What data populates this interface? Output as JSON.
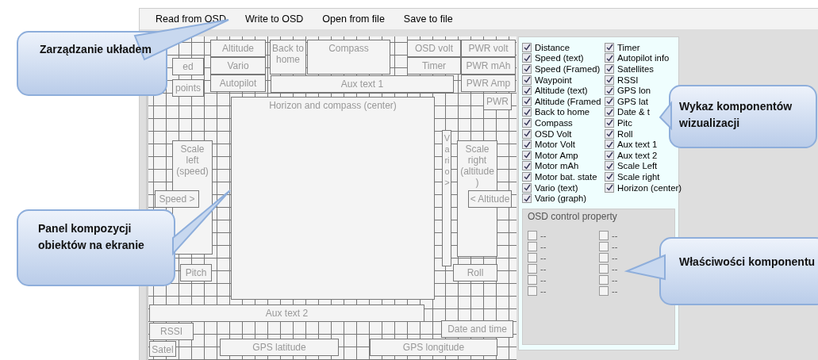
{
  "menu": [
    {
      "label": "Read from OSD"
    },
    {
      "label": "Write to OSD"
    },
    {
      "label": "Open from file"
    },
    {
      "label": "Save to file"
    }
  ],
  "canvas_items": [
    {
      "label": "Altitude"
    },
    {
      "label": "Vario"
    },
    {
      "label": "Autopilot"
    },
    {
      "label": "Back to home"
    },
    {
      "label": "Compass"
    },
    {
      "label": "OSD volt"
    },
    {
      "label": "PWR volt"
    },
    {
      "label": "Timer"
    },
    {
      "label": "PWR mAh"
    },
    {
      "label": "Aux text 1"
    },
    {
      "label": "PWR Amp"
    },
    {
      "label": "PWR"
    },
    {
      "label": "ed"
    },
    {
      "label": "points"
    },
    {
      "label": "Horizon and compass (center)"
    },
    {
      "label": "Scale left (speed)"
    },
    {
      "label": "Speed >"
    },
    {
      "label": "Vario >"
    },
    {
      "label": "Scale right (altitude )"
    },
    {
      "label": "< Altitude"
    },
    {
      "label": "Pitch"
    },
    {
      "label": "Roll"
    },
    {
      "label": "Aux text 2"
    },
    {
      "label": "RSSI"
    },
    {
      "label": "Date and time"
    },
    {
      "label": "Satel"
    },
    {
      "label": "GPS latitude"
    },
    {
      "label": "GPS longitude"
    }
  ],
  "components": [
    {
      "label": "Distance",
      "checked": true
    },
    {
      "label": "Speed (text)",
      "checked": true
    },
    {
      "label": "Speed (Framed)",
      "checked": true
    },
    {
      "label": "Waypoint",
      "checked": true
    },
    {
      "label": "Altitude (text)",
      "checked": true
    },
    {
      "label": "Altitude (Framed",
      "checked": true
    },
    {
      "label": "Back to home",
      "checked": true
    },
    {
      "label": "Compass",
      "checked": true
    },
    {
      "label": "OSD Volt",
      "checked": true
    },
    {
      "label": "Motor Volt",
      "checked": true
    },
    {
      "label": "Motor Amp",
      "checked": true
    },
    {
      "label": "Motor mAh",
      "checked": true
    },
    {
      "label": "Motor bat. state",
      "checked": true
    },
    {
      "label": "Vario (text)",
      "checked": true
    },
    {
      "label": "Vario (graph)",
      "checked": true
    },
    {
      "label": "Timer",
      "checked": true
    },
    {
      "label": "Autopilot info",
      "checked": true
    },
    {
      "label": "Satellites",
      "checked": true
    },
    {
      "label": "RSSI",
      "checked": true
    },
    {
      "label": "GPS lon",
      "checked": true
    },
    {
      "label": "GPS lat",
      "checked": true
    },
    {
      "label": "Date & t",
      "checked": true
    },
    {
      "label": "Pitc",
      "checked": true
    },
    {
      "label": "Roll",
      "checked": true
    },
    {
      "label": "Aux text 1",
      "checked": true
    },
    {
      "label": "Aux text 2",
      "checked": true
    },
    {
      "label": "Scale Left",
      "checked": true
    },
    {
      "label": "Scale right",
      "checked": true
    },
    {
      "label": "Horizon (center)",
      "checked": true
    }
  ],
  "property_group": {
    "title": "OSD control property",
    "items": [
      {
        "label": "--",
        "checked": false
      },
      {
        "label": "--",
        "checked": false
      },
      {
        "label": "--",
        "checked": false
      },
      {
        "label": "--",
        "checked": false
      },
      {
        "label": "--",
        "checked": false
      },
      {
        "label": "--",
        "checked": false
      },
      {
        "label": "--",
        "checked": false
      },
      {
        "label": "--",
        "checked": false
      },
      {
        "label": "--",
        "checked": false
      },
      {
        "label": "--",
        "checked": false
      },
      {
        "label": "--",
        "checked": false
      },
      {
        "label": "--",
        "checked": false
      }
    ]
  },
  "callouts": [
    {
      "text": "Zarządzanie układem"
    },
    {
      "text": "Panel kompozycji obiektów na ekranie"
    },
    {
      "text": "Wykaz komponentów wizualizacji"
    },
    {
      "text": "Właściwości komponentu"
    }
  ]
}
